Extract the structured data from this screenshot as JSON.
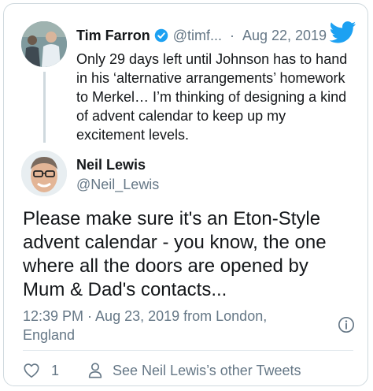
{
  "quoted_tweet": {
    "author_name": "Tim Farron",
    "handle": "@timf...",
    "separator": "·",
    "date": "Aug 22, 2019",
    "text": "Only 29 days left until Johnson has to hand in his ‘alternative arrangements’ homework to Merkel… I’m thinking of designing a kind of advent calendar to keep up my excitement levels."
  },
  "reply": {
    "author_name": "Neil Lewis",
    "handle": "@Neil_Lewis",
    "text": "Please make sure it's an Eton-Style advent calendar - you know, the one where all the doors are opened by Mum & Dad's contacts...",
    "meta": "12:39 PM · Aug 23, 2019 from London, England"
  },
  "actions": {
    "like_count": "1",
    "other_tweets_label": "See Neil Lewis’s other Tweets"
  },
  "icons": {
    "verified": "verified-badge-icon",
    "brand": "twitter-bird-icon",
    "info": "info-icon",
    "like": "heart-icon",
    "profile": "person-icon"
  },
  "colors": {
    "brand_blue": "#1da1f2",
    "text_primary": "#14171a",
    "text_secondary": "#657786",
    "border": "#cfd9de"
  }
}
